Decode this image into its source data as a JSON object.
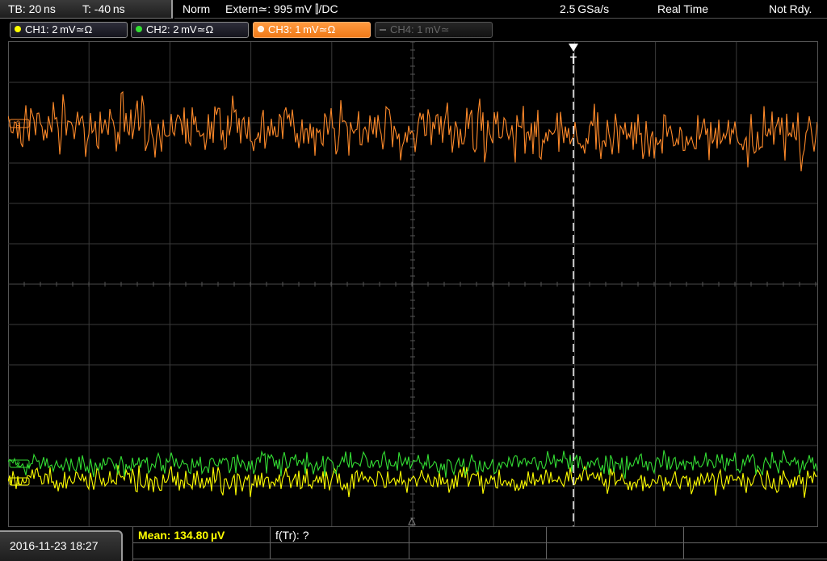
{
  "status": {
    "timebase": "TB: 20 ns",
    "trigger_offset": "T: -40 ns",
    "trigger_mode": "Norm",
    "trigger_source": "Extern≃: 995 mV ⫿/DC",
    "sample_rate": "2.5 GSa/s",
    "acq_mode": "Real Time",
    "state": "Not Rdy."
  },
  "channels": [
    {
      "label": "CH1: 2 mV≃Ω",
      "color": "#ffff00",
      "active": true
    },
    {
      "label": "CH2: 2 mV≃Ω",
      "color": "#33dd33",
      "active": true
    },
    {
      "label": "CH3: 1 mV≃Ω",
      "color": "#ff8a2a",
      "active": true,
      "selected": true
    },
    {
      "label": "CH4: 1 mV≃",
      "color": "#666666",
      "active": false
    }
  ],
  "markers": {
    "trigger": "T",
    "ch3_ref": "3",
    "ch2_ref": "2",
    "ch1_ref": "1"
  },
  "datetime": "2016-11-23 18:27",
  "measurements": {
    "mean": "Mean: 134.80 µV",
    "freq": "f(Tr): ?"
  },
  "colors": {
    "ch1": "#ffff00",
    "ch2": "#33dd33",
    "ch3": "#ff8a2a",
    "grid": "#3a3a3a",
    "trigger": "#ffffff"
  }
}
